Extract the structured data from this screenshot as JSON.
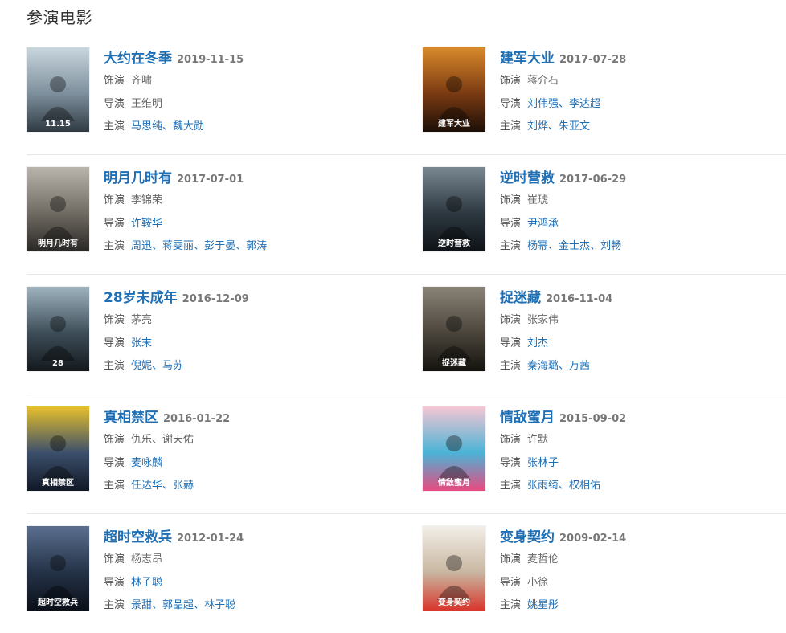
{
  "section_title": "参演电影",
  "labels": {
    "role": "饰演",
    "director": "导演",
    "cast": "主演"
  },
  "movies": [
    {
      "title": "大约在冬季",
      "date": "2019-11-15",
      "role": "齐啸",
      "directors": [
        "王维明"
      ],
      "directors_linked": false,
      "cast": [
        "马思纯",
        "魏大勋"
      ],
      "poster_text": "11.15",
      "poster_colors": [
        "#c9d6de",
        "#7d8f9c",
        "#2f3a42"
      ]
    },
    {
      "title": "建军大业",
      "date": "2017-07-28",
      "role": "蒋介石",
      "directors": [
        "刘伟强",
        "李达超"
      ],
      "directors_linked": true,
      "cast": [
        "刘烨",
        "朱亚文"
      ],
      "poster_text": "建军大业",
      "poster_colors": [
        "#d98a2b",
        "#7a3a12",
        "#1c0f07"
      ]
    },
    {
      "title": "明月几时有",
      "date": "2017-07-01",
      "role": "李锦荣",
      "directors": [
        "许鞍华"
      ],
      "directors_linked": true,
      "cast": [
        "周迅",
        "蒋雯丽",
        "彭于晏",
        "郭涛"
      ],
      "poster_text": "明月几时有",
      "poster_colors": [
        "#b9b5ad",
        "#6f6a62",
        "#2a2826"
      ]
    },
    {
      "title": "逆时营救",
      "date": "2017-06-29",
      "role": "崔琥",
      "directors": [
        "尹鸿承"
      ],
      "directors_linked": true,
      "cast": [
        "杨幂",
        "金士杰",
        "刘畅"
      ],
      "poster_text": "逆时营救",
      "poster_colors": [
        "#7a8892",
        "#2d3840",
        "#0e1216"
      ]
    },
    {
      "title": "28岁未成年",
      "date": "2016-12-09",
      "role": "茅亮",
      "directors": [
        "张末"
      ],
      "directors_linked": true,
      "cast": [
        "倪妮",
        "马苏"
      ],
      "poster_text": "28",
      "poster_colors": [
        "#9fb3bf",
        "#3d4d58",
        "#14191d"
      ]
    },
    {
      "title": "捉迷藏",
      "date": "2016-11-04",
      "role": "张家伟",
      "directors": [
        "刘杰"
      ],
      "directors_linked": true,
      "cast": [
        "秦海璐",
        "万茜"
      ],
      "poster_text": "捉迷藏",
      "poster_colors": [
        "#8a8478",
        "#4a443b",
        "#15130f"
      ]
    },
    {
      "title": "真相禁区",
      "date": "2016-01-22",
      "role": "仇乐、谢天佑",
      "directors": [
        "麦咏麟"
      ],
      "directors_linked": true,
      "cast": [
        "任达华",
        "张赫"
      ],
      "poster_text": "真相禁区",
      "poster_colors": [
        "#e7c02a",
        "#3b4f6b",
        "#111827"
      ]
    },
    {
      "title": "情敌蜜月",
      "date": "2015-09-02",
      "role": "许默",
      "directors": [
        "张林子"
      ],
      "directors_linked": true,
      "cast": [
        "张雨绮",
        "权相佑"
      ],
      "poster_text": "情敌蜜月",
      "poster_colors": [
        "#f5c6d3",
        "#4bb3d6",
        "#e84a80"
      ]
    },
    {
      "title": "超时空救兵",
      "date": "2012-01-24",
      "role": "杨志昂",
      "directors": [
        "林子聪"
      ],
      "directors_linked": true,
      "cast": [
        "景甜",
        "郭品超",
        "林子聪"
      ],
      "poster_text": "超时空救兵",
      "poster_colors": [
        "#5b6f8f",
        "#243247",
        "#0a0f18"
      ]
    },
    {
      "title": "变身契约",
      "date": "2009-02-14",
      "role": "麦哲伦",
      "directors": [
        "小徐"
      ],
      "directors_linked": false,
      "cast": [
        "姚星彤"
      ],
      "poster_text": "变身契约",
      "poster_colors": [
        "#f2eee8",
        "#c8b6a0",
        "#d8362c"
      ]
    }
  ]
}
